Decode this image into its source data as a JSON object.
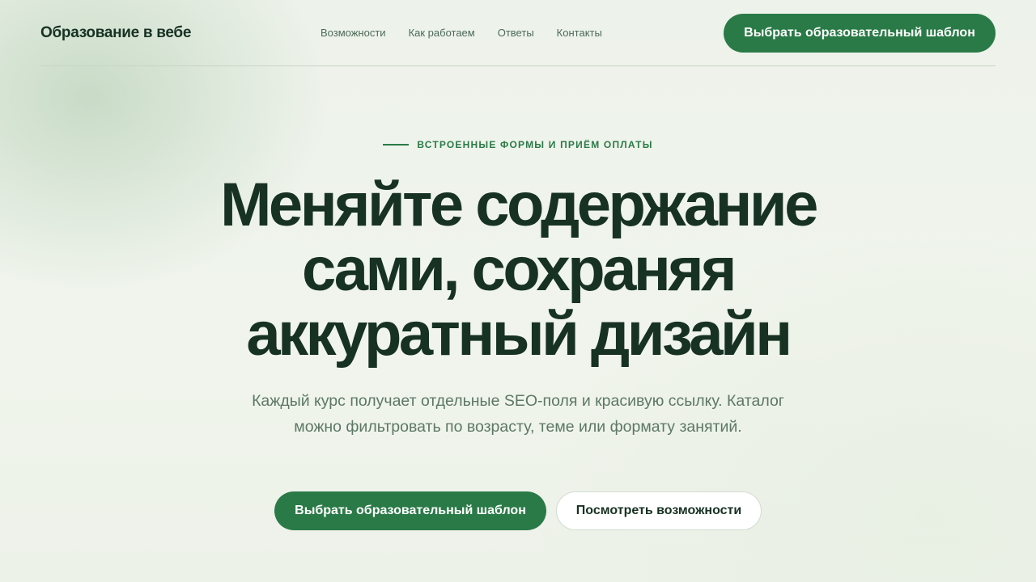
{
  "header": {
    "brand": "Образование в вебе",
    "nav": [
      "Возможности",
      "Как работаем",
      "Ответы",
      "Контакты"
    ],
    "cta_label": "Выбрать образовательный шаблон"
  },
  "hero": {
    "eyebrow": "ВСТРОЕННЫЕ ФОРМЫ И ПРИЁМ ОПЛАТЫ",
    "title_lines": [
      "Меняйте содержание",
      "сами, сохраняя",
      "аккуратный дизайн"
    ],
    "subtitle": "Каждый курс получает отдельные SEO-поля и красивую ссылку. Каталог можно фильтровать по возрасту, теме или формату занятий.",
    "primary_label": "Выбрать образовательный шаблон",
    "secondary_label": "Посмотреть возможности"
  },
  "colors": {
    "accent": "#2a7a47",
    "heading": "#173222",
    "background": "#eef3ea"
  }
}
